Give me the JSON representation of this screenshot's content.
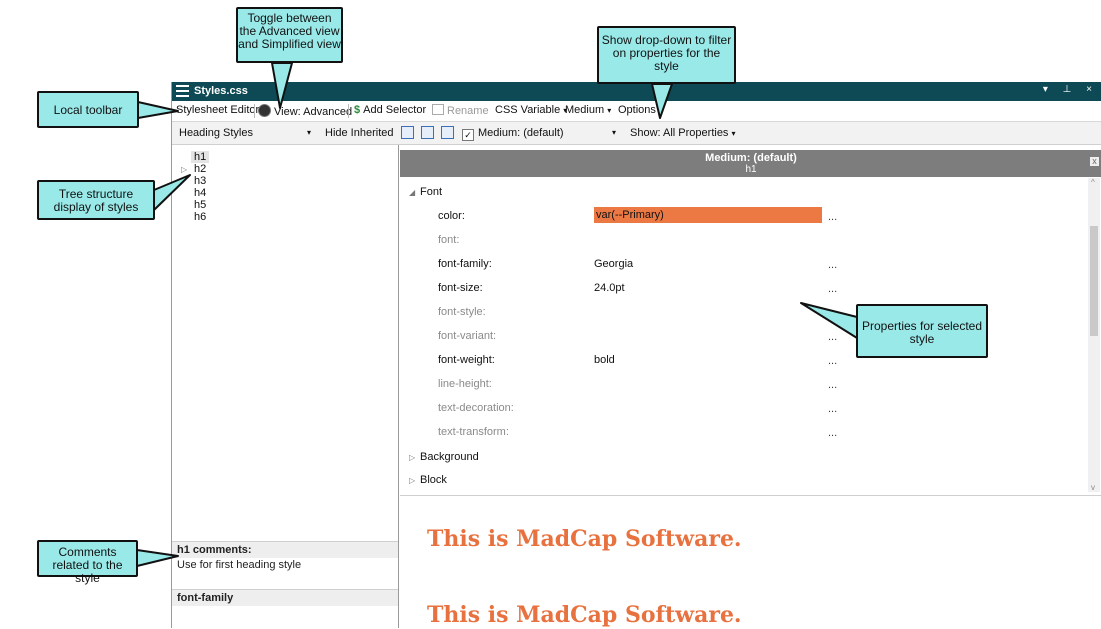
{
  "window": {
    "title": "Styles.css",
    "controls": "▾ ⊥ ×"
  },
  "toolbar": {
    "stylesheet_editor": "Stylesheet Editor",
    "view": "View: Advanced",
    "add_selector": "Add Selector",
    "rename": "Rename",
    "css_variable": "CSS Variable",
    "medium": "Medium",
    "options": "Options"
  },
  "toolbar2": {
    "style_group": "Heading Styles",
    "hide_inherited": "Hide Inherited",
    "medium_select": "Medium: (default)",
    "show": "Show: All Properties"
  },
  "tree": {
    "items": [
      "h1",
      "h2",
      "h3",
      "h4",
      "h5",
      "h6"
    ]
  },
  "comments": {
    "header": "h1 comments:",
    "text": "Use for first heading style",
    "property_header": "font-family"
  },
  "properties": {
    "header_title": "Medium: (default)",
    "header_sub": "h1",
    "group_font": "Font",
    "group_background": "Background",
    "group_block": "Block",
    "rows": [
      {
        "name": "color:",
        "value": "var(--Primary)",
        "dots": "..."
      },
      {
        "name": "font:",
        "value": "",
        "dots": ""
      },
      {
        "name": "font-family:",
        "value": "Georgia",
        "dots": "..."
      },
      {
        "name": "font-size:",
        "value": "24.0pt",
        "dots": "..."
      },
      {
        "name": "font-style:",
        "value": "",
        "dots": "..."
      },
      {
        "name": "font-variant:",
        "value": "",
        "dots": "..."
      },
      {
        "name": "font-weight:",
        "value": "bold",
        "dots": "..."
      },
      {
        "name": "line-height:",
        "value": "",
        "dots": "..."
      },
      {
        "name": "text-decoration:",
        "value": "",
        "dots": "..."
      },
      {
        "name": "text-transform:",
        "value": "",
        "dots": "..."
      }
    ]
  },
  "preview": {
    "line1": "This is MadCap Software.",
    "line2": "This is MadCap Software."
  },
  "callouts": {
    "toggle_view": "Toggle between the Advanced view and Simplified view",
    "show_dropdown": "Show drop-down to filter on properties for the style",
    "local_toolbar": "Local toolbar",
    "tree_structure": "Tree structure display of styles",
    "properties_selected": "Properties for selected style",
    "comments_related": "Comments related to the style"
  },
  "colors": {
    "titlebar": "#0e4a55",
    "highlight": "#ec7843",
    "preview_text": "#e8723f",
    "callout_fill": "#9ae9e9"
  }
}
